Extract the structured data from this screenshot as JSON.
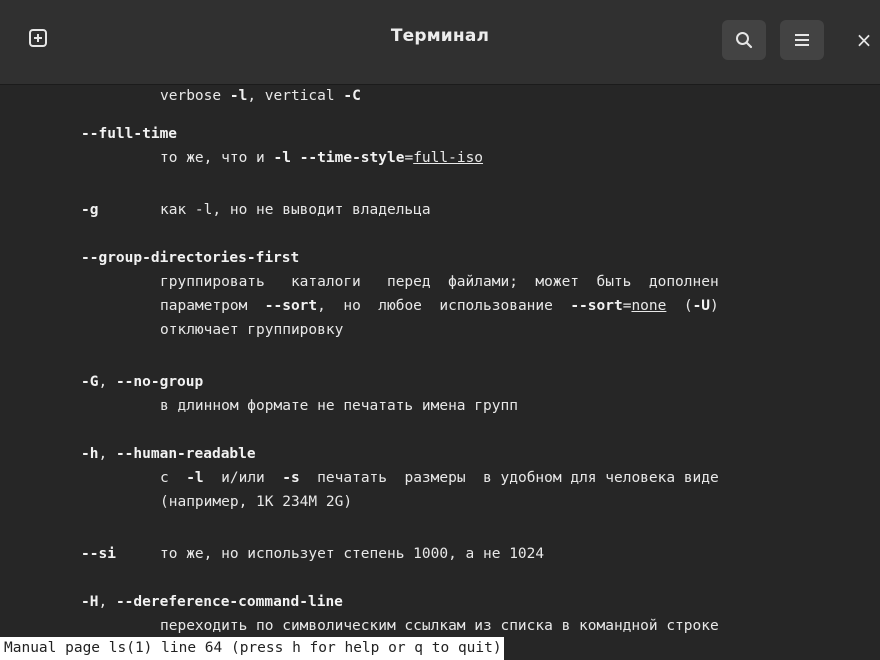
{
  "window": {
    "title": "Терминал",
    "icons": {
      "new_tab": "plus-square-icon",
      "search": "search-icon",
      "menu": "hamburger-menu-icon",
      "close": "close-icon"
    },
    "close_glyph": "×"
  },
  "manpage": {
    "l1": {
      "a": "verbose ",
      "b": "-l",
      "c": ", vertical ",
      "d": "-C"
    },
    "full_time": {
      "opt": "--full-time",
      "desc_a": "то же, что и ",
      "desc_b": "-l --time-style",
      "desc_c": "=",
      "desc_d": "full-iso"
    },
    "g": {
      "opt": "-g",
      "desc": "как -l, но не выводит владельца"
    },
    "gdf": {
      "opt": "--group-directories-first",
      "l1": "группировать   каталоги   перед  файлами;  может  быть  дополнен",
      "l2_a": "параметром  ",
      "l2_b": "--sort",
      "l2_c": ",  но  любое  использование  ",
      "l2_d": "--sort",
      "l2_e": "=",
      "l2_f": "none",
      "l2_g": "  (",
      "l2_h": "-U",
      "l2_i": ")",
      "l3": "отключает группировку"
    },
    "G": {
      "opt_a": "-G",
      "opt_b": ", ",
      "opt_c": "--no-group",
      "desc": "в длинном формате не печатать имена групп"
    },
    "h": {
      "opt_a": "-h",
      "opt_b": ", ",
      "opt_c": "--human-readable",
      "l1_a": "с  ",
      "l1_b": "-l",
      "l1_c": "  и/или  ",
      "l1_d": "-s",
      "l1_e": "  печатать  размеры  в удобном для человека виде",
      "l2": "(например, 1K 234M 2G)"
    },
    "si": {
      "opt": "--si",
      "desc": "то же, но использует степень 1000, а не 1024"
    },
    "H": {
      "opt_a": "-H",
      "opt_b": ", ",
      "opt_c": "--dereference-command-line",
      "desc": "переходить по символическим ссылкам из списка в командной строке"
    }
  },
  "status_bar": {
    "text": "Manual page ls(1) line 64 (press h for help or q to quit)"
  }
}
